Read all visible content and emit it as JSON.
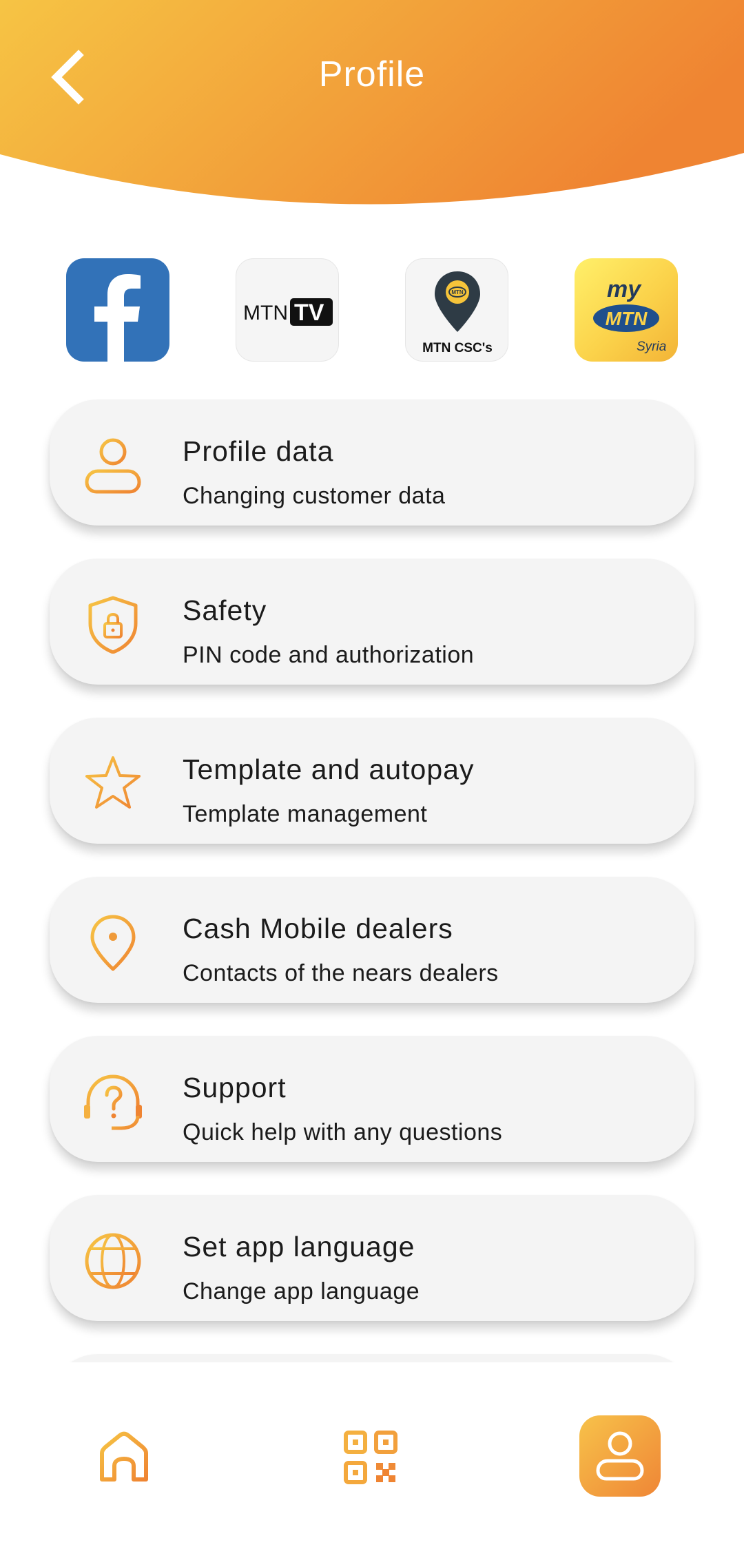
{
  "header": {
    "title": "Profile",
    "gradient_start": "#f6c444",
    "gradient_end": "#ef8432"
  },
  "shortcuts": [
    {
      "name": "facebook",
      "icon": "facebook-icon"
    },
    {
      "name": "mtn-tv",
      "icon": "mtn-tv-logo",
      "logo_text_a": "MTN",
      "logo_text_b": "TV"
    },
    {
      "name": "mtn-cscs",
      "icon": "mtn-csc-pin-logo",
      "logo_text": "MTN CSC's",
      "badge": "MTN"
    },
    {
      "name": "my-mtn",
      "icon": "my-mtn-logo",
      "logo_my": "my",
      "logo_mtn": "MTN",
      "logo_country": "Syria"
    }
  ],
  "menu": [
    {
      "title": "Profile data",
      "subtitle": "Changing customer data",
      "icon": "user-icon"
    },
    {
      "title": "Safety",
      "subtitle": "PIN code and authorization",
      "icon": "shield-lock-icon"
    },
    {
      "title": "Template and autopay",
      "subtitle": "Template management",
      "icon": "star-icon"
    },
    {
      "title": "Cash Mobile dealers",
      "subtitle": "Contacts of the nears dealers",
      "icon": "location-pin-icon"
    },
    {
      "title": "Support",
      "subtitle": "Quick help with any questions",
      "icon": "headset-question-icon"
    },
    {
      "title": "Set app language",
      "subtitle": "Change app language",
      "icon": "globe-icon"
    }
  ],
  "bottom_nav": [
    {
      "name": "home",
      "icon": "home-icon",
      "active": false
    },
    {
      "name": "qr",
      "icon": "qr-code-icon",
      "active": false
    },
    {
      "name": "profile",
      "icon": "user-icon",
      "active": true
    }
  ],
  "colors": {
    "accent_light": "#f6c444",
    "accent_dark": "#ef8432",
    "card_bg": "#f4f4f4",
    "facebook_blue": "#3272b8"
  }
}
